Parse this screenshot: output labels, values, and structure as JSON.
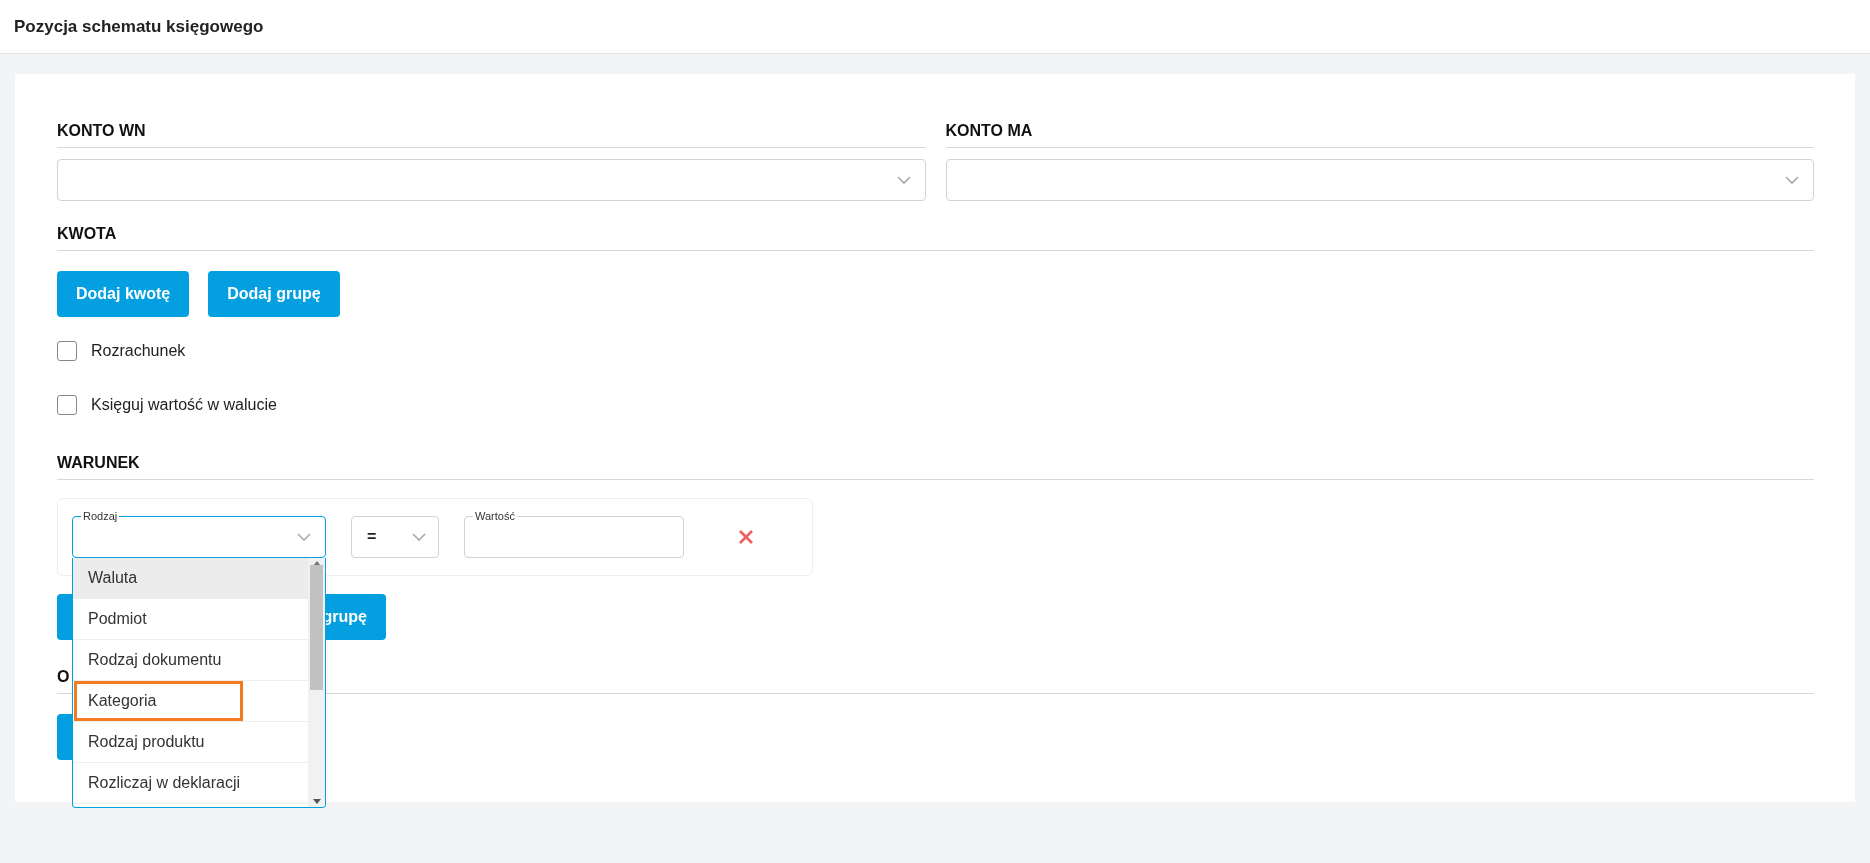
{
  "header": {
    "title": "Pozycja schematu księgowego"
  },
  "accounts": [
    {
      "label": "KONTO WN"
    },
    {
      "label": "KONTO MA"
    }
  ],
  "amount": {
    "label": "KWOTA",
    "buttons": [
      "Dodaj kwotę",
      "Dodaj grupę"
    ]
  },
  "checkboxes": [
    {
      "label": "Rozrachunek",
      "checked": false
    },
    {
      "label": "Księguj wartość w walucie",
      "checked": false
    }
  ],
  "condition": {
    "label": "WARUNEK",
    "type_field": {
      "label": "Rodzaj",
      "expanded": true
    },
    "operator": "=",
    "value_field": {
      "label": "Wartość"
    },
    "options": [
      {
        "label": "Waluta",
        "hovered": true,
        "highlighted": false
      },
      {
        "label": "Podmiot",
        "hovered": false,
        "highlighted": false
      },
      {
        "label": "Rodzaj dokumentu",
        "hovered": false,
        "highlighted": false
      },
      {
        "label": "Kategoria",
        "hovered": false,
        "highlighted": true
      },
      {
        "label": "Rodzaj produktu",
        "hovered": false,
        "highlighted": false
      },
      {
        "label": "Rozliczaj w deklaracji",
        "hovered": false,
        "highlighted": false
      }
    ],
    "buttons": [
      "grupę"
    ]
  },
  "section_4": {
    "label": "O"
  }
}
